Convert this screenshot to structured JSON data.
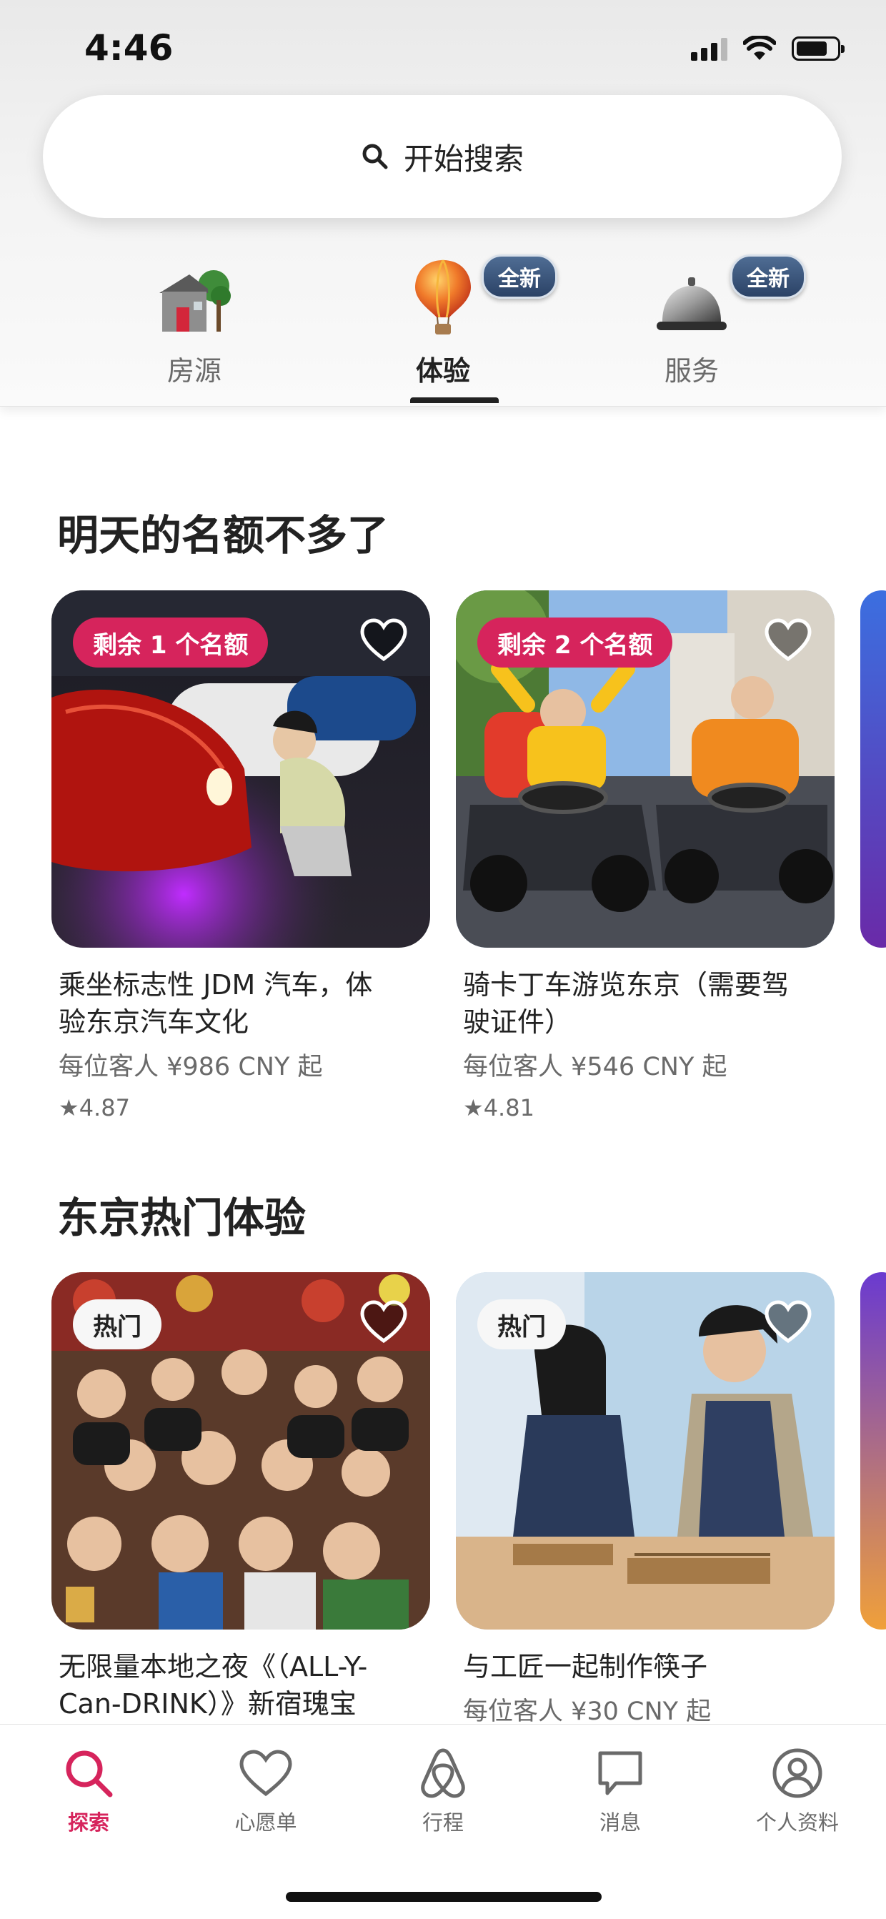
{
  "status_bar": {
    "time": "4:46"
  },
  "search": {
    "label": "开始搜索",
    "icon": "search-icon"
  },
  "categories": [
    {
      "label": "房源",
      "icon": "house-icon",
      "badge": ""
    },
    {
      "label": "体验",
      "icon": "hot-air-balloon-icon",
      "badge": "全新",
      "active": true
    },
    {
      "label": "服务",
      "icon": "service-bell-icon",
      "badge": "全新"
    }
  ],
  "section1": {
    "title": "明天的名额不多了",
    "cards": [
      {
        "badge": "剩余 1 个名额",
        "title_line1": "乘坐标志性 JDM 汽车，体",
        "title_line2": "验东京汽车文化",
        "price": "每位客人 ¥986 CNY 起",
        "rating": "4.87"
      },
      {
        "badge": "剩余 2 个名额",
        "title_line1": "骑卡丁车游览东京（需要驾",
        "title_line2": "驶证件）",
        "price": "每位客人 ¥546 CNY 起",
        "rating": "4.81"
      }
    ]
  },
  "section2": {
    "title": "东京热门体验",
    "cards": [
      {
        "badge": "热门",
        "title_line1": "无限量本地之夜《（ALL-Y-",
        "title_line2": "Can-DRINK）》新宿瑰宝"
      },
      {
        "badge": "热门",
        "title_line1": "与工匠一起制作筷子",
        "price": "每位客人 ¥30 CNY 起"
      }
    ]
  },
  "tabbar": {
    "items": [
      {
        "label": "探索",
        "icon": "search-icon",
        "active": true
      },
      {
        "label": "心愿单",
        "icon": "heart-icon"
      },
      {
        "label": "行程",
        "icon": "airbnb-logo-icon"
      },
      {
        "label": "消息",
        "icon": "message-icon"
      },
      {
        "label": "个人资料",
        "icon": "profile-icon"
      }
    ]
  },
  "colors": {
    "accent": "#D6245C",
    "text": "#222222",
    "muted": "#6A6A6A"
  }
}
